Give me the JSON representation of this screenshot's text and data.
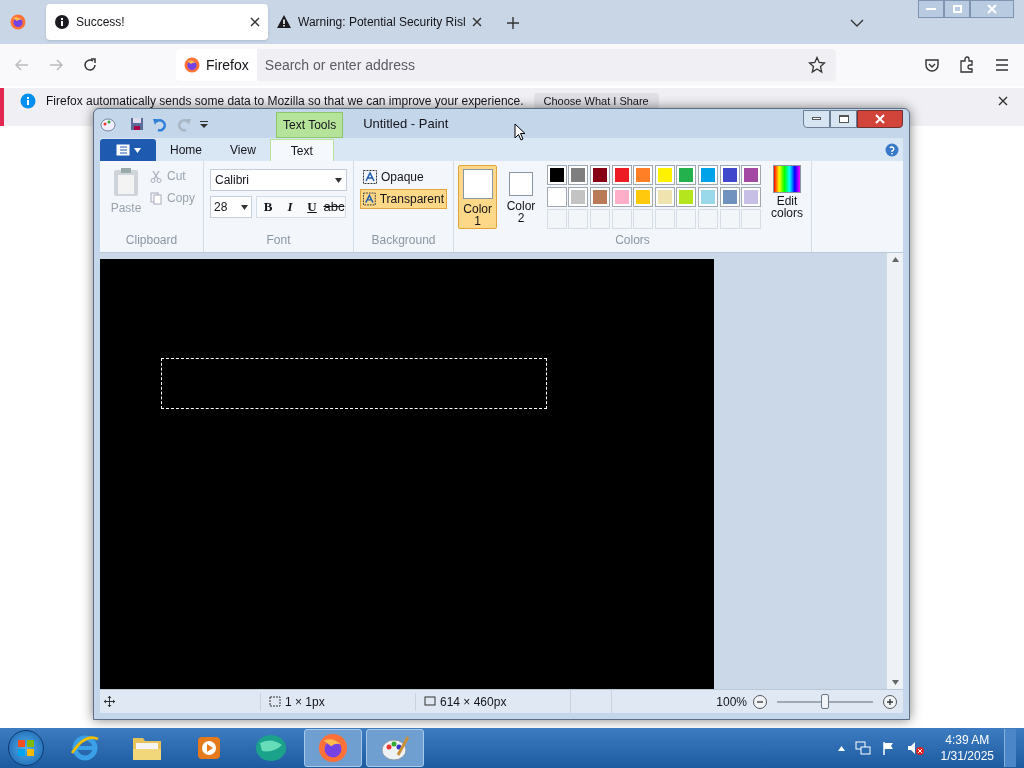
{
  "browser": {
    "tabs": [
      {
        "title": "Success!",
        "selected": true,
        "kind": "info"
      },
      {
        "title": "Warning: Potential Security Risl",
        "selected": false,
        "kind": "warning"
      }
    ],
    "identity": "Firefox",
    "address_placeholder": "Search or enter address",
    "notification": {
      "text": "Firefox automatically sends some data to Mozilla so that we can improve your experience.",
      "button": "Choose What I Share"
    }
  },
  "paint": {
    "title": "Untitled - Paint",
    "context_tab": "Text Tools",
    "ribbon_tabs": [
      {
        "label": "Home",
        "selected": false
      },
      {
        "label": "View",
        "selected": false
      },
      {
        "label": "Text",
        "selected": true
      }
    ],
    "clipboard": {
      "paste": "Paste",
      "cut": "Cut",
      "copy": "Copy",
      "disabled": true,
      "label": "Clipboard"
    },
    "font": {
      "name": "Calibri",
      "size": "28",
      "label": "Font",
      "styles": [
        {
          "label": "B",
          "kind": "bold"
        },
        {
          "label": "I",
          "kind": "italic"
        },
        {
          "label": "U",
          "kind": "underline"
        },
        {
          "label": "abc",
          "kind": "strike"
        }
      ]
    },
    "background": {
      "label": "Background",
      "options": [
        {
          "label": "Opaque",
          "selected": false
        },
        {
          "label": "Transparent",
          "selected": true
        }
      ]
    },
    "color_slots": [
      {
        "label": "Color",
        "number": "1",
        "selected": true
      },
      {
        "label": "Color",
        "number": "2",
        "selected": false
      }
    ],
    "palette": [
      {
        "color": "#000000"
      },
      {
        "color": "#7f7f7f"
      },
      {
        "color": "#880015"
      },
      {
        "color": "#ed1c24"
      },
      {
        "color": "#ff7f27"
      },
      {
        "color": "#fff200"
      },
      {
        "color": "#22b14c"
      },
      {
        "color": "#00a2e8"
      },
      {
        "color": "#3f48cc"
      },
      {
        "color": "#a349a4"
      },
      {
        "color": "#ffffff"
      },
      {
        "color": "#c3c3c3"
      },
      {
        "color": "#b97a57"
      },
      {
        "color": "#ffaec9"
      },
      {
        "color": "#ffc90e"
      },
      {
        "color": "#efe4b0"
      },
      {
        "color": "#b5e61d"
      },
      {
        "color": "#99d9ea"
      },
      {
        "color": "#7092be"
      },
      {
        "color": "#c8bfe7"
      },
      {
        "kind": "empty"
      },
      {
        "kind": "empty"
      },
      {
        "kind": "empty"
      },
      {
        "kind": "empty"
      },
      {
        "kind": "empty"
      },
      {
        "kind": "empty"
      },
      {
        "kind": "empty"
      },
      {
        "kind": "empty"
      },
      {
        "kind": "empty"
      },
      {
        "kind": "empty"
      }
    ],
    "edit_colors": "Edit colors",
    "colors_label": "Colors",
    "status": {
      "selection": "1 × 1px",
      "canvas_size": "614 × 460px",
      "zoom": "100%",
      "zoom_slider": {
        "level": 0.5
      }
    }
  },
  "taskbar": {
    "apps": [
      {
        "kind": "ie",
        "selected": false
      },
      {
        "kind": "explorer",
        "selected": false
      },
      {
        "kind": "media",
        "selected": false
      },
      {
        "kind": "globe",
        "selected": false
      },
      {
        "kind": "firefox",
        "selected": true
      },
      {
        "kind": "paint",
        "selected": true
      }
    ],
    "time": "4:39 AM",
    "date": "1/31/2025"
  }
}
